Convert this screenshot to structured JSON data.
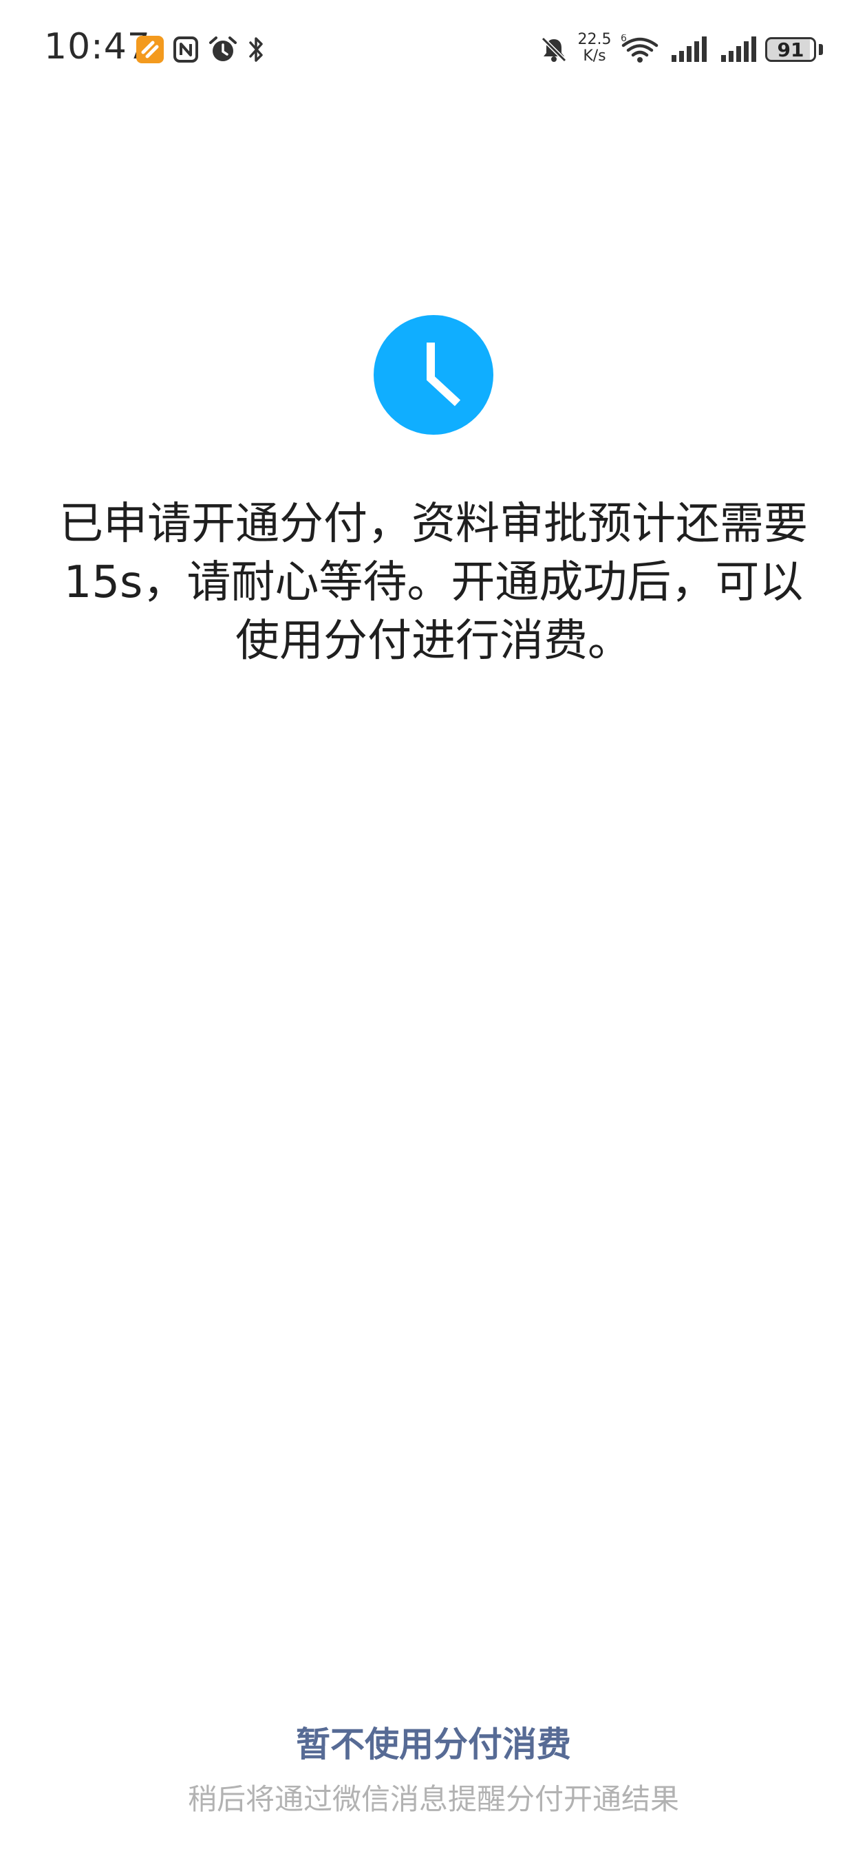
{
  "status_bar": {
    "time": "10:47",
    "net_speed_value": "22.5",
    "net_speed_unit": "K/s",
    "battery_level": "91",
    "icons": [
      "app-badge-icon",
      "nfc-icon",
      "alarm-icon",
      "bluetooth-icon",
      "mute-icon",
      "wifi-icon",
      "signal-icon",
      "signal-icon",
      "battery-icon"
    ]
  },
  "main": {
    "status_icon": "clock-icon",
    "accent_color": "#10aeff",
    "message": "已申请开通分付，资料审批预计还需要15s，请耐心等待。开通成功后，可以使用分付进行消费。"
  },
  "footer": {
    "skip_label": "暂不使用分付消费",
    "skip_color": "#576b95",
    "note": "稍后将通过微信消息提醒分付开通结果"
  }
}
